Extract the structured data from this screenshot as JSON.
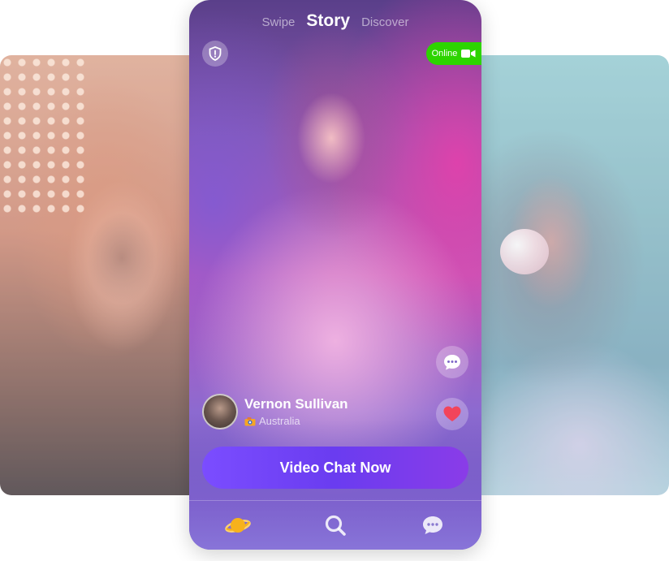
{
  "top_tabs": {
    "swipe": "Swipe",
    "story": "Story",
    "discover": "Discover"
  },
  "status": {
    "online": "Online"
  },
  "profile": {
    "name": "Vernon Sullivan",
    "location": "Australia"
  },
  "cta": {
    "label": "Video Chat Now"
  },
  "colors": {
    "online_green": "#2dd400",
    "cta_purple": "#7b4dff",
    "heart_red": "#f2445a",
    "planet_yellow": "#f7b21c"
  },
  "icons": [
    "shield-icon",
    "video-camera-icon",
    "chat-bubble-icon",
    "heart-icon",
    "camera-emoji-icon",
    "planet-icon",
    "search-icon",
    "message-icon"
  ]
}
